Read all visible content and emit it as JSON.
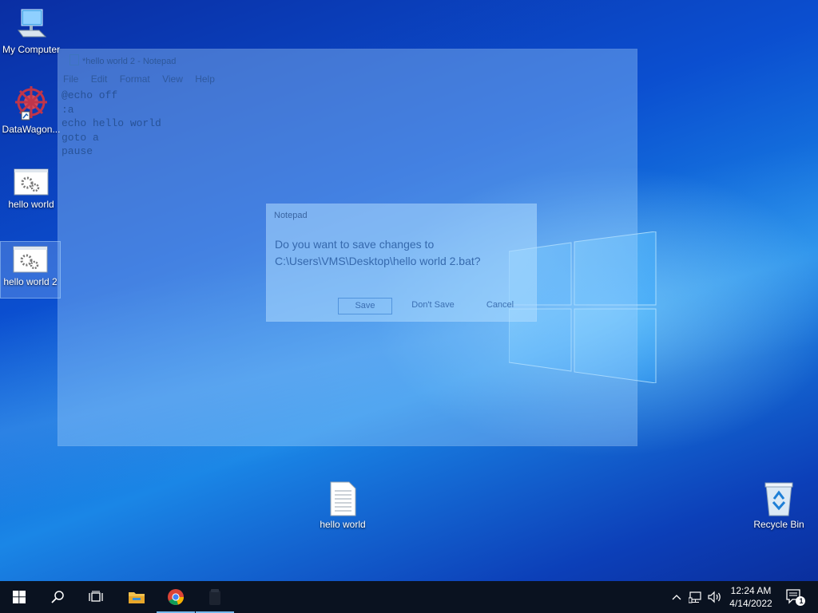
{
  "desktop": {
    "icons": {
      "my_computer": "My Computer",
      "datawagon": "DataWagon...",
      "hello_world": "hello world",
      "hello_world_2": "hello world 2",
      "hello_world_txt": "hello world",
      "recycle_bin": "Recycle Bin"
    }
  },
  "notepad": {
    "title": "*hello world 2 - Notepad",
    "menu": [
      "File",
      "Edit",
      "Format",
      "View",
      "Help"
    ],
    "content": "@echo off\n:a\necho hello world\ngoto a\npause"
  },
  "dialog": {
    "title": "Notepad",
    "message_line1": "Do you want to save changes to",
    "message_line2": "C:\\Users\\VMS\\Desktop\\hello world 2.bat?",
    "save": "Save",
    "dont_save": "Don't Save",
    "cancel": "Cancel"
  },
  "taskbar": {
    "time": "12:24 AM",
    "date": "4/14/2022",
    "notifications": "1",
    "icons": [
      "windows-start-icon",
      "search-icon",
      "task-view-icon",
      "file-explorer-icon",
      "chrome-icon",
      "notepad-taskbar-icon"
    ]
  },
  "colors": {
    "taskbar": "#0a1220",
    "accent": "#76b9ed"
  }
}
